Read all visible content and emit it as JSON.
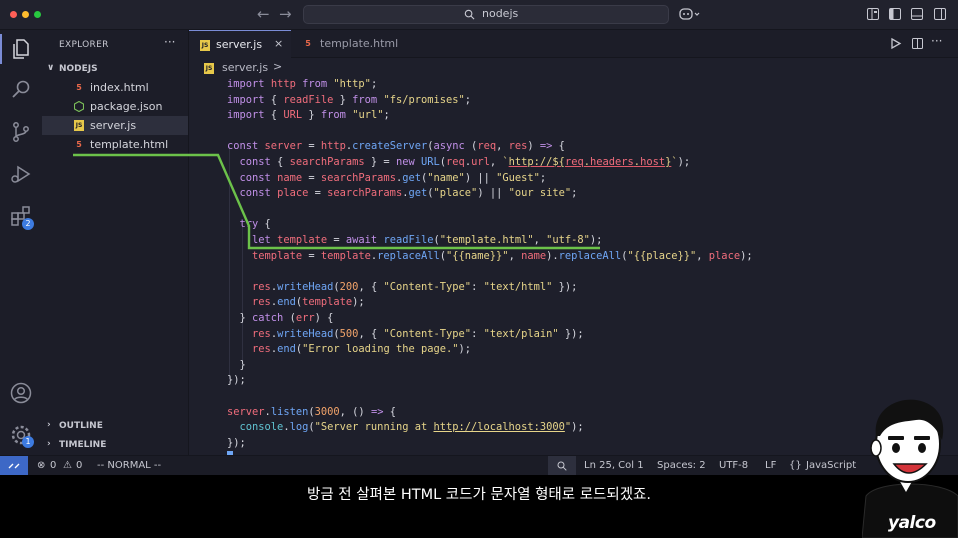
{
  "titlebar": {
    "search_text": "nodejs",
    "colors": {
      "close": "#ff5f57",
      "minimize": "#febc2e",
      "zoom": "#28c840"
    }
  },
  "activity": {
    "icons": [
      "explorer-icon",
      "search-icon",
      "source-control-icon",
      "run-debug-icon",
      "extensions-icon",
      "account-icon",
      "manage-gear-icon"
    ],
    "extensions_badge": "2",
    "manage_badge": "1"
  },
  "sidebar": {
    "title": "EXPLORER",
    "more": "···",
    "folder": "NODEJS",
    "files": [
      {
        "name": "index.html",
        "icon": "html-file-icon"
      },
      {
        "name": "package.json",
        "icon": "nodejs-file-icon"
      },
      {
        "name": "server.js",
        "icon": "js-file-icon"
      },
      {
        "name": "template.html",
        "icon": "html-file-icon"
      }
    ],
    "outline": "OUTLINE",
    "timeline": "TIMELINE"
  },
  "tabs": [
    {
      "label": "server.js",
      "icon": "js-file-icon",
      "active": true
    },
    {
      "label": "template.html",
      "icon": "html-file-icon",
      "active": false
    }
  ],
  "breadcrumb": {
    "file": "server.js",
    "sep": ">"
  },
  "statusbar": {
    "errors": "0",
    "warnings": "0",
    "mode": "-- NORMAL --",
    "position": "Ln 25, Col 1",
    "spaces": "Spaces: 2",
    "encoding": "UTF-8",
    "eol": "LF",
    "language": "JavaScript",
    "language_prefix": "{}"
  },
  "subtitle": "방금 전 살펴본 HTML 코드가 문자열 형태로 로드되겠죠.",
  "logo": "yalco",
  "colors": {
    "accent": "#7b8cd6",
    "remote": "#3d68c6",
    "highlight": "#6cc24a"
  }
}
